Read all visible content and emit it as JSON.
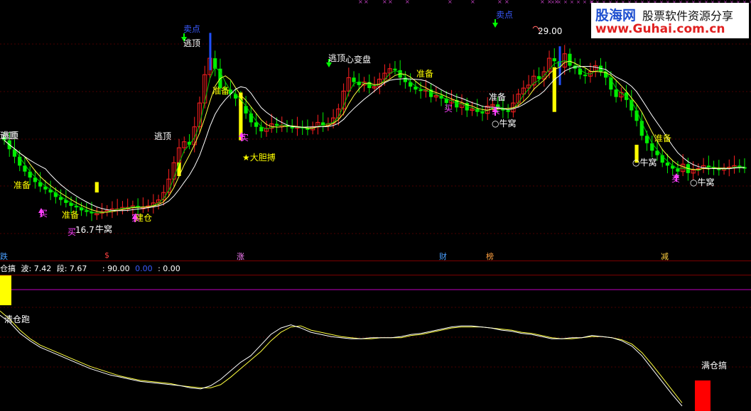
{
  "logo": {
    "brand": "股海网",
    "tagline": "股票软件资源分享",
    "url": "www.Guhai.com.cn"
  },
  "price_labels": [
    {
      "text": "逃顶",
      "cls": "white"
    },
    {
      "text": "卖点",
      "cls": "blue"
    },
    {
      "text": "逃顶",
      "cls": "white"
    },
    {
      "text": "准备",
      "cls": "yellow"
    },
    {
      "text": "★大胆搏",
      "cls": "yellow"
    },
    {
      "text": "逃顶",
      "cls": "white"
    },
    {
      "text": "心变盘",
      "cls": "white"
    },
    {
      "text": "准备",
      "cls": "yellow"
    },
    {
      "text": "买",
      "cls": "magenta"
    },
    {
      "text": "卖点",
      "cls": "blue"
    },
    {
      "text": "29.00",
      "cls": "white"
    },
    {
      "text": "准备",
      "cls": "white"
    },
    {
      "text": "买",
      "cls": "magenta"
    },
    {
      "text": "○牛窝",
      "cls": "white"
    },
    {
      "text": "逃顶",
      "cls": "white"
    },
    {
      "text": "准备",
      "cls": "yellow"
    },
    {
      "text": "买",
      "cls": "magenta"
    },
    {
      "text": "准备",
      "cls": "yellow"
    },
    {
      "text": "买",
      "cls": "magenta"
    },
    {
      "text": "16.7",
      "cls": "white"
    },
    {
      "text": "牛窝",
      "cls": "white"
    },
    {
      "text": "建仓",
      "cls": "yellow"
    },
    {
      "text": "实",
      "cls": "magenta"
    },
    {
      "text": "准备",
      "cls": "yellow"
    },
    {
      "text": "○牛窝",
      "cls": "white"
    },
    {
      "text": "买",
      "cls": "magenta"
    },
    {
      "text": "○牛窝",
      "cls": "white"
    },
    {
      "text": "逃顶",
      "cls": "white"
    },
    {
      "text": "实",
      "cls": "magenta"
    }
  ],
  "axis_markers": [
    {
      "text": "跌",
      "color": "#4aa0ff"
    },
    {
      "text": "$",
      "color": "#ff4040"
    },
    {
      "text": "涨",
      "color": "#ff80ff"
    },
    {
      "text": "财",
      "color": "#4aa0ff"
    },
    {
      "text": "榜",
      "color": "#ffa040"
    },
    {
      "text": "减",
      "color": "#ffd040"
    }
  ],
  "indicator": {
    "name": "仓搞",
    "wave_label": "波: 7.42",
    "segment_label": "段: 7.67",
    "v1": ": 90.00",
    "v2": "0.00",
    "v3": ": 0.00",
    "left_signal": "清仓跑",
    "right_signal": "满仓搞"
  },
  "colors": {
    "up": "#ff2020",
    "down": "#00ee00",
    "signal_yellow": "#ffff00",
    "ma_white": "#ffffff",
    "ma_yellow": "#ffff40",
    "ma_green": "#00cc00",
    "purple_line": "#c000c0"
  },
  "chart_data": {
    "type": "candlestick",
    "price_high_label": 29.0,
    "price_low_label": 16.7,
    "close": [
      22.1,
      21.5,
      21.0,
      20.4,
      20.0,
      19.6,
      19.3,
      19.0,
      18.8,
      18.6,
      18.3,
      18.1,
      17.9,
      17.7,
      17.6,
      17.4,
      17.3,
      17.2,
      17.2,
      17.3,
      17.4,
      17.5,
      17.5,
      17.6,
      17.6,
      17.7,
      17.6,
      17.6,
      17.7,
      17.9,
      18.1,
      18.6,
      19.5,
      20.6,
      21.6,
      22.0,
      21.8,
      23.0,
      24.6,
      26.5,
      27.6,
      26.9,
      25.6,
      25.5,
      25.2,
      24.9,
      24.4,
      23.9,
      23.3,
      23.0,
      22.7,
      22.9,
      23.2,
      23.1,
      23.1,
      23.0,
      22.9,
      23.0,
      22.9,
      22.8,
      23.0,
      23.3,
      23.1,
      23.2,
      23.6,
      24.2,
      25.4,
      26.3,
      26.0,
      25.8,
      26.0,
      25.6,
      25.7,
      26.2,
      26.6,
      26.9,
      26.8,
      26.3,
      26.0,
      25.7,
      25.5,
      25.4,
      25.5,
      25.0,
      25.1,
      24.9,
      24.6,
      24.8,
      24.3,
      24.6,
      24.1,
      24.2,
      24.0,
      23.9,
      24.4,
      24.5,
      24.2,
      24.1,
      24.0,
      24.6,
      25.2,
      25.6,
      25.8,
      26.4,
      26.2,
      26.7,
      27.6,
      27.4,
      27.0,
      27.9,
      27.1,
      26.9,
      26.5,
      26.4,
      26.7,
      27.1,
      26.7,
      26.3,
      25.5,
      25.0,
      25.3,
      24.8,
      24.1,
      23.4,
      22.4,
      21.9,
      21.4,
      21.1,
      20.6,
      20.4,
      20.2,
      20.0,
      20.5,
      19.9,
      20.1,
      20.2,
      20.4,
      20.3,
      20.2,
      20.1,
      20.2,
      20.3,
      20.4,
      20.3,
      20.2
    ],
    "indicator_white": [
      62,
      55,
      45,
      38,
      32,
      28,
      24,
      20,
      16,
      12,
      9,
      6,
      4,
      2,
      0,
      -1,
      -2,
      -3,
      -4,
      -6,
      -7,
      -4,
      2,
      10,
      18,
      24,
      34,
      44,
      50,
      53,
      50,
      46,
      44,
      42,
      41,
      40,
      40,
      41,
      41,
      41,
      42,
      44,
      45,
      47,
      49,
      51,
      52,
      52,
      51,
      50,
      48,
      47,
      45,
      44,
      42,
      40,
      40,
      41,
      41,
      43,
      42,
      41,
      38,
      33,
      24,
      12,
      0,
      -12,
      -23
    ],
    "indicator_yellow": [
      66,
      58,
      48,
      40,
      34,
      30,
      26,
      22,
      18,
      14,
      11,
      8,
      5,
      3,
      1,
      0,
      -1,
      -2,
      -4,
      -5,
      -6,
      -6,
      -3,
      4,
      12,
      20,
      28,
      38,
      46,
      51,
      52,
      48,
      46,
      44,
      42,
      41,
      40,
      40,
      41,
      41,
      41,
      43,
      44,
      46,
      48,
      50,
      51,
      51,
      51,
      50,
      49,
      48,
      46,
      45,
      43,
      41,
      40,
      40,
      41,
      42,
      42,
      41,
      39,
      35,
      27,
      16,
      4,
      -8,
      -20
    ]
  }
}
